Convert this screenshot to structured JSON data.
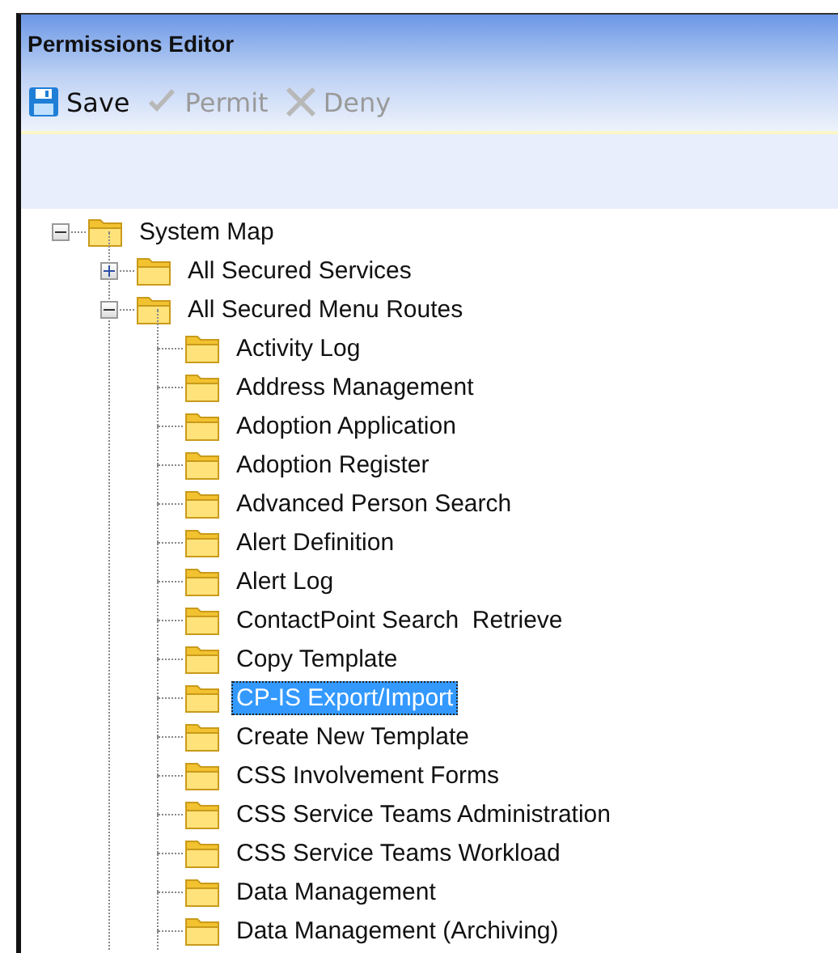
{
  "window": {
    "title": "Permissions Editor"
  },
  "toolbar": [
    {
      "label": "Save",
      "kind": "save",
      "disabled": false
    },
    {
      "label": "Permit",
      "kind": "permit",
      "disabled": true
    },
    {
      "label": "Deny",
      "kind": "deny",
      "disabled": true
    }
  ],
  "tree": [
    {
      "label": "System Map",
      "expanded": true,
      "selected": false,
      "children": [
        {
          "label": "All Secured Services",
          "expanded": false,
          "selected": false,
          "has_children": true
        },
        {
          "label": "All Secured Menu Routes",
          "expanded": true,
          "selected": false,
          "children": [
            {
              "label": "Activity Log",
              "selected": false
            },
            {
              "label": "Address Management",
              "selected": false
            },
            {
              "label": "Adoption Application",
              "selected": false
            },
            {
              "label": "Adoption Register",
              "selected": false
            },
            {
              "label": "Advanced Person Search",
              "selected": false
            },
            {
              "label": "Alert Definition",
              "selected": false
            },
            {
              "label": "Alert Log",
              "selected": false
            },
            {
              "label": "ContactPoint Search  Retrieve",
              "selected": false
            },
            {
              "label": "Copy Template",
              "selected": false
            },
            {
              "label": "CP-IS Export/Import",
              "selected": true
            },
            {
              "label": "Create New Template",
              "selected": false
            },
            {
              "label": "CSS Involvement Forms",
              "selected": false
            },
            {
              "label": "CSS Service Teams Administration",
              "selected": false
            },
            {
              "label": "CSS Service Teams Workload",
              "selected": false
            },
            {
              "label": "Data Management",
              "selected": false
            },
            {
              "label": "Data Management (Archiving)",
              "selected": false
            }
          ]
        }
      ]
    }
  ]
}
